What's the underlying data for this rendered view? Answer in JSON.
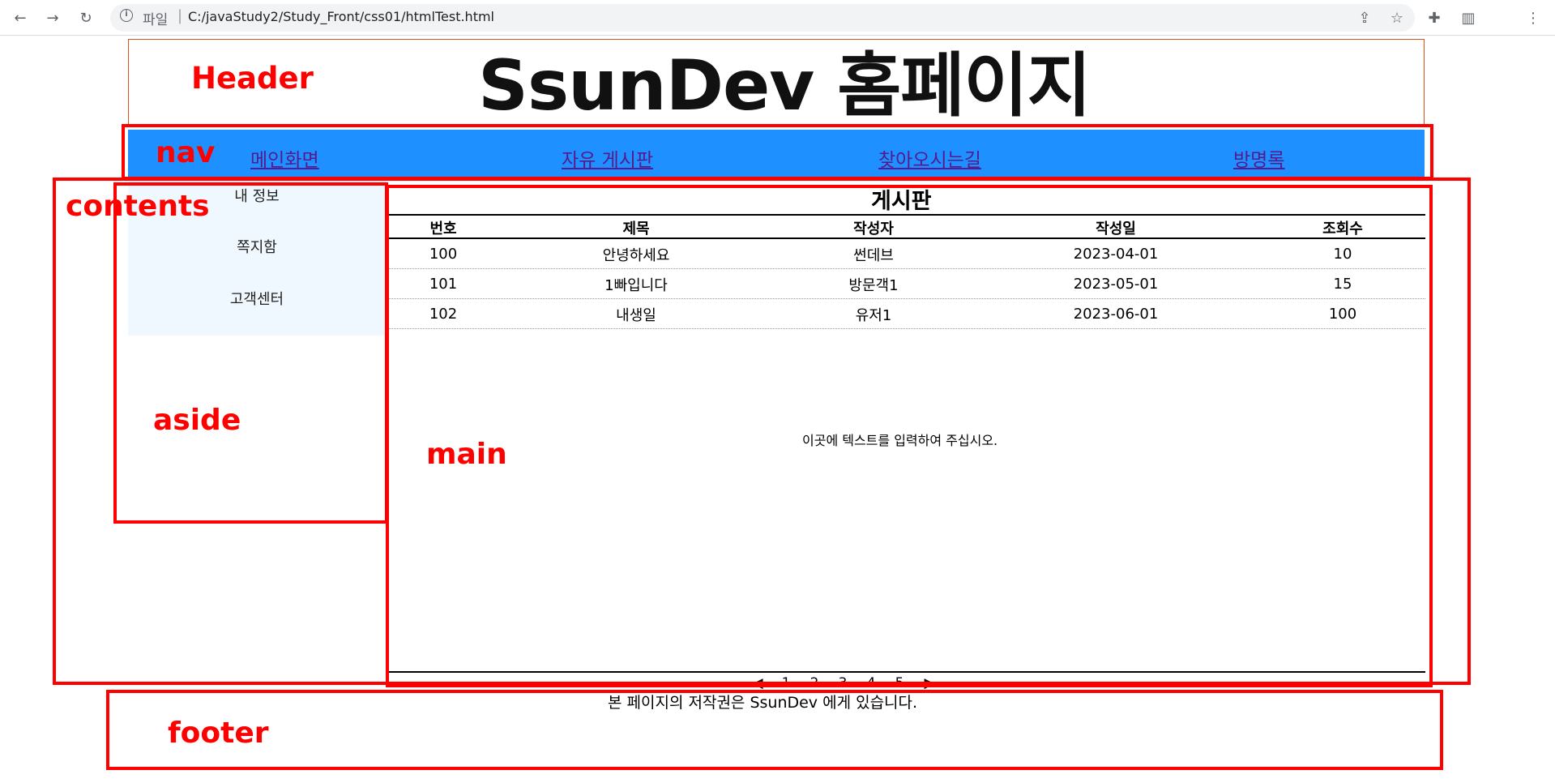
{
  "browser": {
    "file_label": "파일",
    "url": "C:/javaStudy2/Study_Front/css01/htmlTest.html"
  },
  "header": {
    "title": "SsunDev 홈페이지"
  },
  "nav": {
    "items": [
      "메인화면",
      "자유 게시판",
      "찾아오시는길",
      "방명록"
    ]
  },
  "aside": {
    "items": [
      "내 정보",
      "쪽지함",
      "고객센터"
    ]
  },
  "main": {
    "board_title": "게시판",
    "columns": [
      "번호",
      "제목",
      "작성자",
      "작성일",
      "조회수"
    ],
    "rows": [
      [
        "100",
        "안녕하세요",
        "썬데브",
        "2023-04-01",
        "10"
      ],
      [
        "101",
        "1빠입니다",
        "방문객1",
        "2023-05-01",
        "15"
      ],
      [
        "102",
        "내생일",
        "유저1",
        "2023-06-01",
        "100"
      ]
    ],
    "placeholder_text": "이곳에 텍스트를 입력하여 주십시오.",
    "pager": [
      "◀",
      "1",
      "2",
      "3",
      "4",
      "5",
      "▶"
    ]
  },
  "footer": {
    "text": "본 페이지의 저작권은 SsunDev 에게 있습니다."
  },
  "annotations": {
    "header": "Header",
    "nav": "nav",
    "contents": "contents",
    "aside": "aside",
    "main": "main",
    "footer": "footer"
  },
  "colors": {
    "nav_bg": "#1e90ff",
    "aside_bg": "#f0f8ff",
    "annotation": "#ff0000",
    "link_visited": "#551a8b"
  }
}
